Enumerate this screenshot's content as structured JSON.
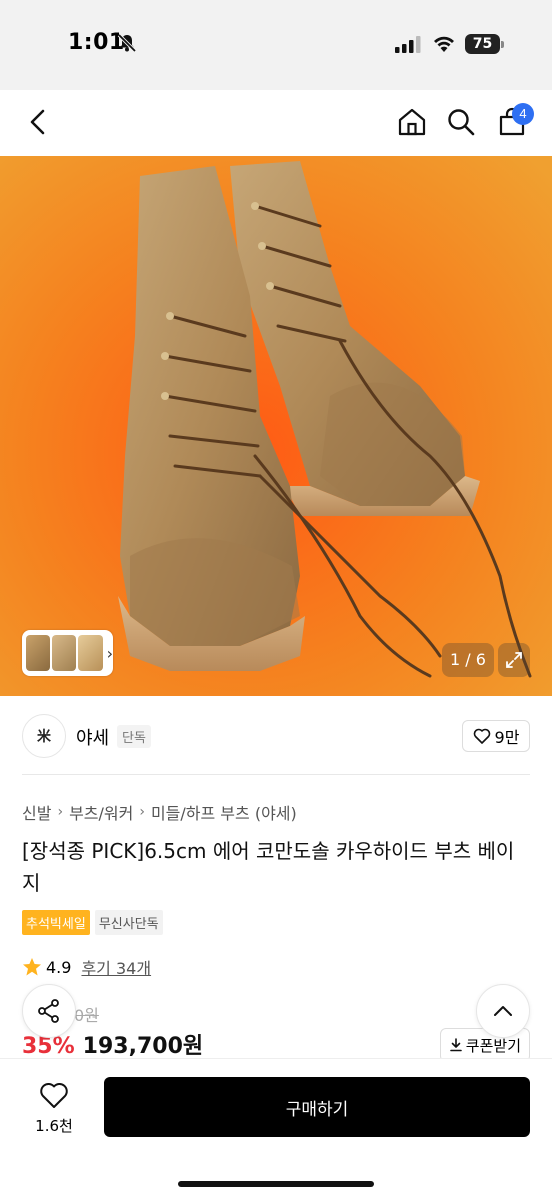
{
  "status": {
    "time": "1:01",
    "battery": "75"
  },
  "header": {
    "cart_count": "4"
  },
  "gallery": {
    "pager": "1 / 6"
  },
  "brand": {
    "logo": "⽶",
    "name": "야세",
    "tag": "단독",
    "likes": "9만"
  },
  "breadcrumb": [
    "신발",
    "부츠/워커",
    "미들/하프 부츠 (야세)"
  ],
  "product": {
    "title": "[장석종 PICK]6.5cm 에어 코만도솔 카우하이드 부츠 베이지",
    "tags": [
      "추석빅세일",
      "무신사단독"
    ],
    "rating": "4.9",
    "reviews": "후기 34개",
    "original_price": "0원",
    "discount": "35%",
    "price": "193,700원",
    "coupon_label": "쿠폰받기"
  },
  "bottom": {
    "wish_count": "1.6천",
    "buy_label": "구매하기"
  },
  "colors": {
    "accent_red": "#e8303a",
    "badge_blue": "#2e6ff2",
    "sale_tag": "#ffb31f",
    "star": "#ffb31f"
  }
}
